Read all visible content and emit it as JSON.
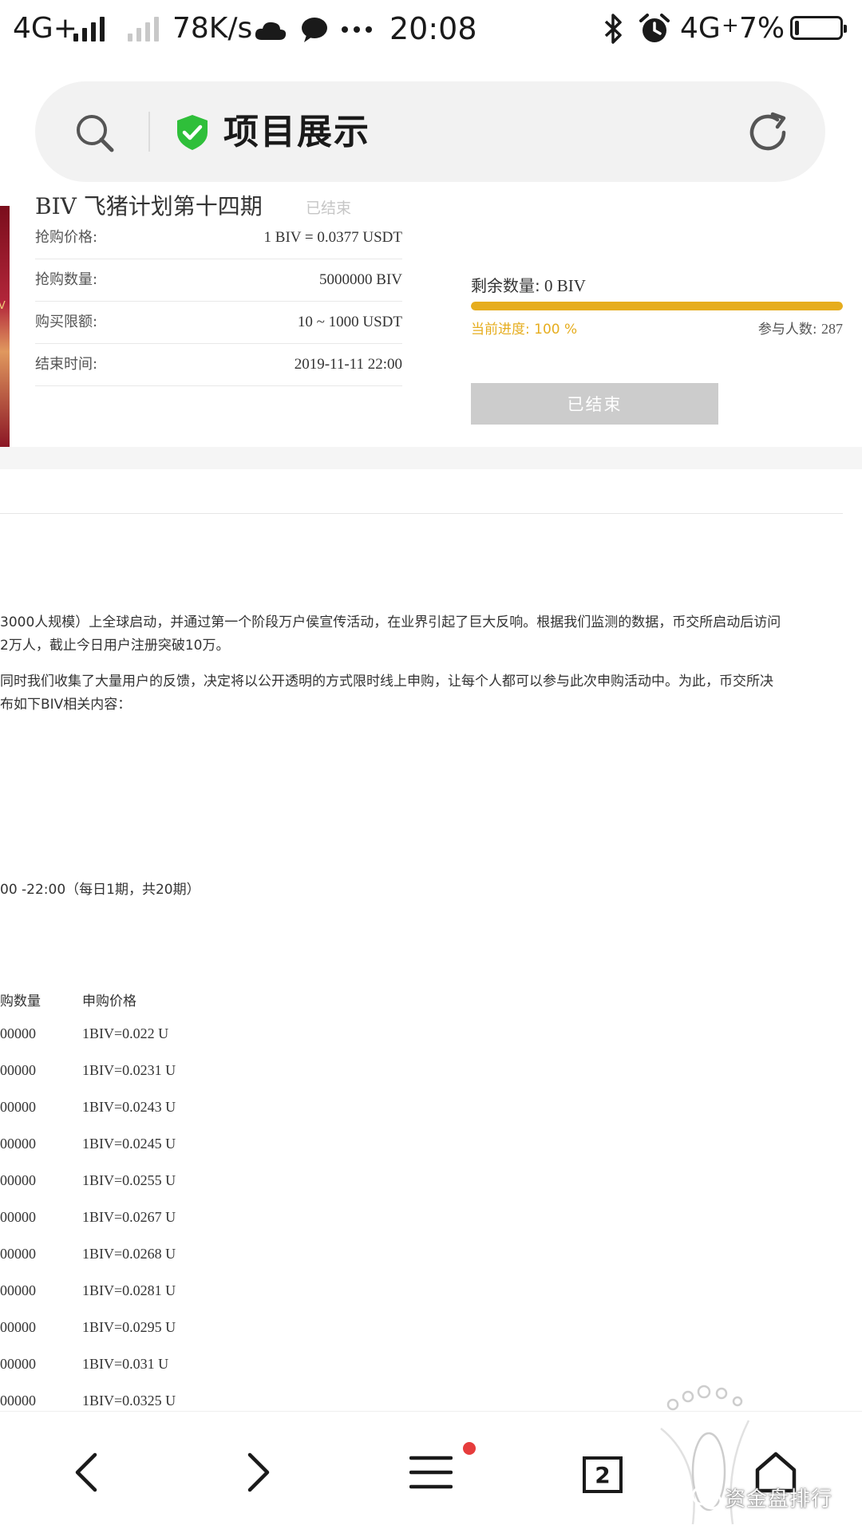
{
  "status_bar": {
    "network": "4G+",
    "speed": "78K/s",
    "time": "20:08",
    "network2": "4G",
    "battery": "7%",
    "battery_level": 0.07
  },
  "address_bar": {
    "title": "项目展示"
  },
  "project": {
    "title": "BIV 飞猪计划第十四期",
    "status": "已结束",
    "image_label": "IV",
    "info": [
      {
        "label": "抢购价格:",
        "value": "1 BIV = 0.0377 USDT"
      },
      {
        "label": "抢购数量:",
        "value": "5000000 BIV"
      },
      {
        "label": "购买限额:",
        "value": "10 ~ 1000 USDT"
      },
      {
        "label": "结束时间:",
        "value": "2019-11-11 22:00"
      }
    ],
    "remaining_label": "剩余数量:",
    "remaining_value": "0 BIV",
    "progress_text": "当前进度: 100 %",
    "progress": 1.0,
    "participants_label": "参与人数:",
    "participants_value": "287",
    "button_label": "已结束"
  },
  "article": {
    "para1_line1": "3000人规模）上全球启动，并通过第一个阶段万户侯宣传活动，在业界引起了巨大反响。根据我们监测的数据，币交所启动后访问",
    "para1_line2": "2万人，截止今日用户注册突破10万。",
    "para2_line1": "同时我们收集了大量用户的反馈，决定将以公开透明的方式限时线上申购，让每个人都可以参与此次申购活动中。为此，币交所决",
    "para2_line2": "布如下BIV相关内容：",
    "schedule": "00 -22:00（每日1期，共20期）",
    "table": {
      "headers": [
        "购数量",
        "申购价格"
      ],
      "rows": [
        {
          "qty": "00000",
          "price": "1BIV=0.022 U"
        },
        {
          "qty": "00000",
          "price": "1BIV=0.0231 U"
        },
        {
          "qty": "00000",
          "price": "1BIV=0.0243 U"
        },
        {
          "qty": "00000",
          "price": "1BIV=0.0245 U"
        },
        {
          "qty": "00000",
          "price": "1BIV=0.0255 U"
        },
        {
          "qty": "00000",
          "price": "1BIV=0.0267 U"
        },
        {
          "qty": "00000",
          "price": "1BIV=0.0268 U"
        },
        {
          "qty": "00000",
          "price": "1BIV=0.0281 U"
        },
        {
          "qty": "00000",
          "price": "1BIV=0.0295 U"
        },
        {
          "qty": "00000",
          "price": "1BIV=0.031 U"
        },
        {
          "qty": "00000",
          "price": "1BIV=0.0325 U"
        }
      ]
    }
  },
  "bottom_nav": {
    "tabs_count": "2",
    "watermark": "资金盘排行"
  },
  "colors": {
    "accent": "#e6ad1e",
    "shield": "#2fbf3a",
    "button_disabled": "#cccccc"
  },
  "icons": [
    "search-icon",
    "shield-check-icon",
    "refresh-icon",
    "back-icon",
    "forward-icon",
    "menu-icon",
    "tabs-icon",
    "home-icon",
    "bluetooth-icon",
    "alarm-icon",
    "cloud-icon",
    "chat-icon"
  ]
}
